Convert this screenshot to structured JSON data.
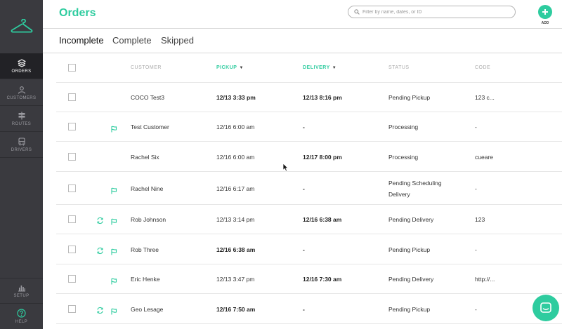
{
  "app": {
    "page_title": "Orders",
    "search_placeholder": "Filter by name, dates, or ID",
    "add_label": "ADD",
    "accent_color": "#2ecc9f"
  },
  "sidebar": {
    "items": [
      {
        "label": "ORDERS",
        "icon": "layers-icon",
        "active": true
      },
      {
        "label": "CUSTOMERS",
        "icon": "person-icon",
        "active": false
      },
      {
        "label": "ROUTES",
        "icon": "signpost-icon",
        "active": false
      },
      {
        "label": "DRIVERS",
        "icon": "bus-icon",
        "active": false
      }
    ],
    "bottom": [
      {
        "label": "SETUP",
        "icon": "bar-chart-icon"
      },
      {
        "label": "HELP",
        "icon": "help-icon"
      }
    ]
  },
  "tabs": [
    {
      "label": "Incomplete",
      "active": true
    },
    {
      "label": "Complete",
      "active": false
    },
    {
      "label": "Skipped",
      "active": false
    }
  ],
  "table": {
    "headers": {
      "customer": "CUSTOMER",
      "pickup": "PICKUP",
      "delivery": "DELIVERY",
      "status": "STATUS",
      "code": "CODE"
    },
    "rows": [
      {
        "sync": false,
        "flag": false,
        "customer": "COCO Test3",
        "pickup": "12/13 3:33 pm",
        "pickup_bold": true,
        "delivery": "12/13 8:16 pm",
        "delivery_bold": true,
        "status": "Pending Pickup",
        "status2": "",
        "code": "123 c..."
      },
      {
        "sync": false,
        "flag": true,
        "customer": "Test Customer",
        "pickup": "12/16 6:00 am",
        "pickup_bold": false,
        "delivery": "-",
        "delivery_bold": true,
        "status": "Processing",
        "status2": "",
        "code": "-"
      },
      {
        "sync": false,
        "flag": false,
        "customer": "Rachel Six",
        "pickup": "12/16 6:00 am",
        "pickup_bold": false,
        "delivery": "12/17 8:00 pm",
        "delivery_bold": true,
        "status": "Processing",
        "status2": "",
        "code": "cueare"
      },
      {
        "sync": false,
        "flag": true,
        "customer": "Rachel Nine",
        "pickup": "12/16 6:17 am",
        "pickup_bold": false,
        "delivery": "-",
        "delivery_bold": true,
        "status": "Pending Scheduling",
        "status2": "Delivery",
        "code": "-"
      },
      {
        "sync": true,
        "flag": true,
        "customer": "Rob Johnson",
        "pickup": "12/13 3:14 pm",
        "pickup_bold": false,
        "delivery": "12/16 6:38 am",
        "delivery_bold": true,
        "status": "Pending Delivery",
        "status2": "",
        "code": "123"
      },
      {
        "sync": true,
        "flag": true,
        "customer": "Rob Three",
        "pickup": "12/16 6:38 am",
        "pickup_bold": true,
        "delivery": "-",
        "delivery_bold": true,
        "status": "Pending Pickup",
        "status2": "",
        "code": "-"
      },
      {
        "sync": false,
        "flag": true,
        "customer": "Eric Henke",
        "pickup": "12/13 3:47 pm",
        "pickup_bold": false,
        "delivery": "12/16 7:30 am",
        "delivery_bold": true,
        "status": "Pending Delivery",
        "status2": "",
        "code": "http://..."
      },
      {
        "sync": true,
        "flag": true,
        "customer": "Geo Lesage",
        "pickup": "12/16 7:50 am",
        "pickup_bold": true,
        "delivery": "-",
        "delivery_bold": true,
        "status": "Pending Pickup",
        "status2": "",
        "code": "-"
      }
    ]
  }
}
